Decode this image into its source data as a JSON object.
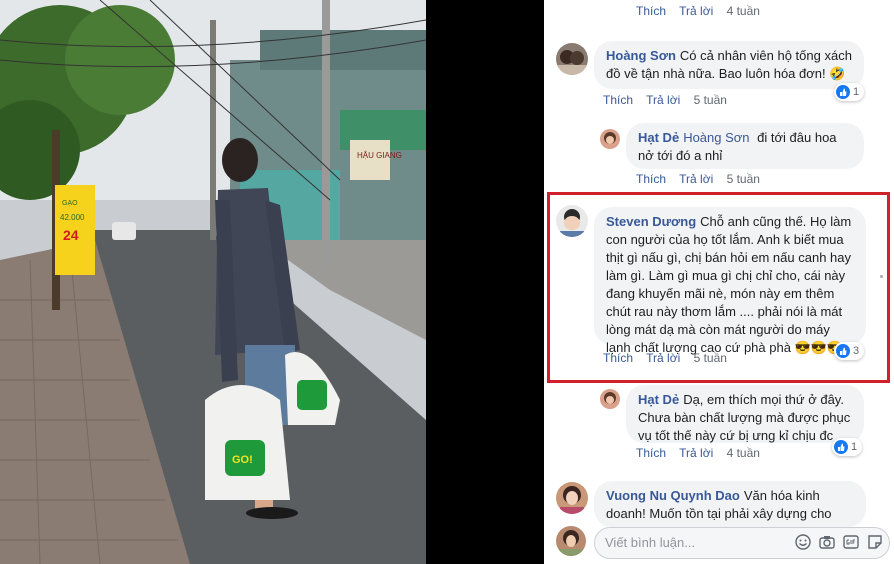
{
  "photo": {
    "sign_text_1": "GẠO",
    "sign_text_2": "42.000",
    "sign_text_3": "24",
    "store_sign": "HẬU GIANG",
    "bag_text": "GO!"
  },
  "comments": [
    {
      "actions": [
        "Thích",
        "Trả lời",
        "4 tuần"
      ]
    },
    {
      "name": "Hoàng Sơn",
      "text": "Có cả nhân viên hộ tống xách đồ về tận nhà nữa. Bao luôn hóa đơn! 🤣",
      "actions": [
        "Thích",
        "Trả lời",
        "5 tuần"
      ],
      "reactions": "1"
    },
    {
      "name": "Hạt Dẻ",
      "mention": "Hoàng Sơn",
      "text": "đi tới đâu hoa nở tới đó a nhỉ",
      "actions": [
        "Thích",
        "Trả lời",
        "5 tuần"
      ]
    },
    {
      "name": "Steven Dương",
      "text": "Chỗ anh cũng thế. Họ làm con người của họ tốt lắm. Anh k biết mua thịt gì nấu gì, chị bán hỏi em nấu canh hay làm gì. Làm gì mua gì chị chỉ cho, cái này đang khuyến mãi nè, món này em thêm chút rau này thơm lắm .... phải nói là mát lòng mát dạ mà còn mát người do máy lạnh chất lượng cao cứ phà phà 😎😎😎",
      "actions": [
        "Thích",
        "Trả lời",
        "5 tuần"
      ],
      "reactions": "3"
    },
    {
      "name": "Hạt Dẻ",
      "text": "Dạ, em thích mọi thứ ở đây. Chưa bàn chất lượng mà được phục vụ tốt thế này cứ bị ưng kỉ chịu đc",
      "actions": [
        "Thích",
        "Trả lời",
        "4 tuần"
      ],
      "reactions": "1"
    },
    {
      "name": "Vuong Nu Quynh Dao",
      "text": "Văn hóa kinh doanh! Muốn tồn tại phải xây dựng cho"
    }
  ],
  "composer": {
    "placeholder": "Viết bình luận..."
  }
}
